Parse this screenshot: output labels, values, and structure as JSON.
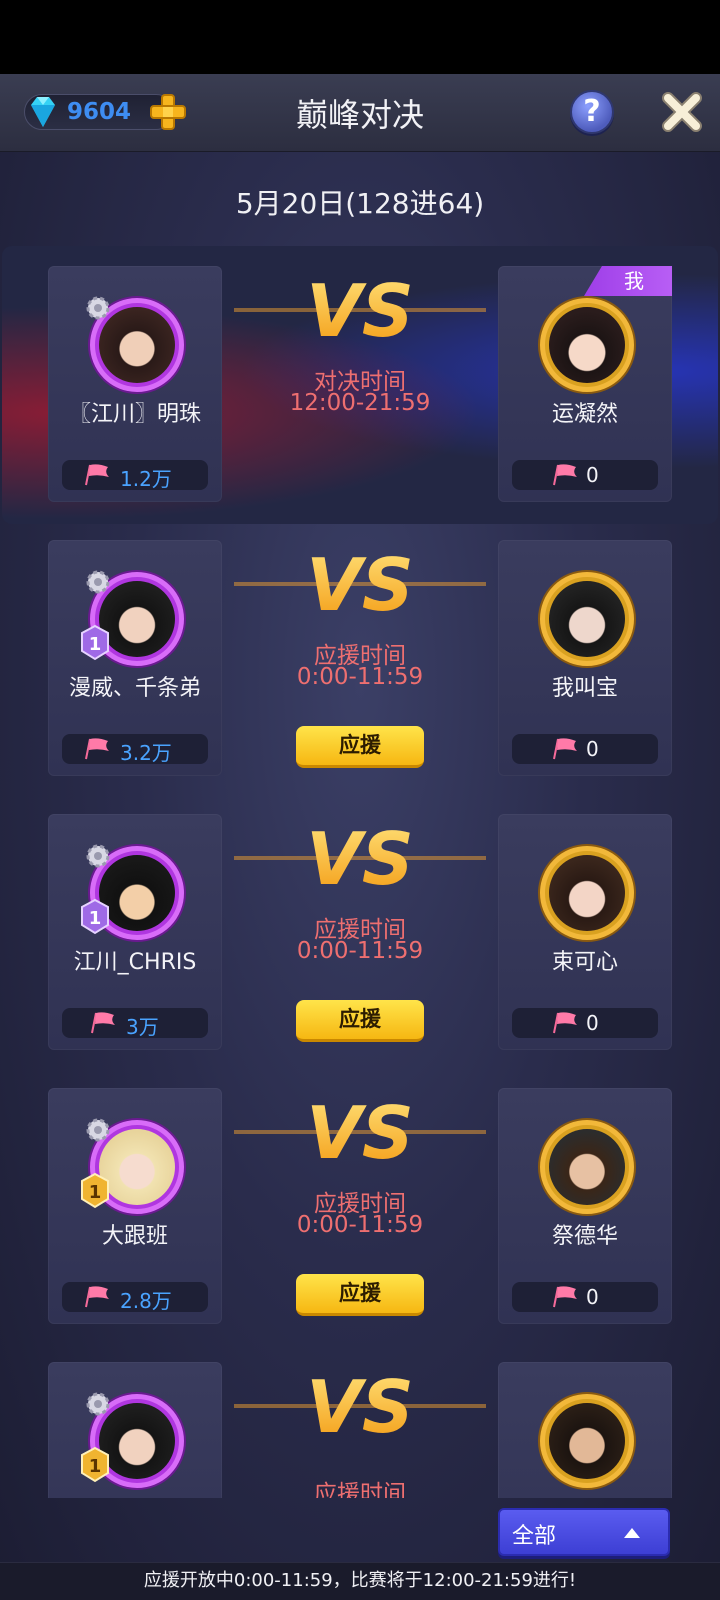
{
  "header": {
    "gem_count": "9604",
    "title": "巅峰对决",
    "help_label": "?"
  },
  "date": "5月20日(128进64)",
  "matches": [
    {
      "left": {
        "name": "〖江川〗明珠",
        "score": "1.2万",
        "rank": ""
      },
      "right": {
        "name": "运凝然",
        "score": "0",
        "tag": "我"
      },
      "time_label": "对决时间",
      "time_range": "12:00-21:59",
      "button": ""
    },
    {
      "left": {
        "name": "漫威、千条弟",
        "score": "3.2万",
        "rank": "1"
      },
      "right": {
        "name": "我叫宝",
        "score": "0"
      },
      "time_label": "应援时间",
      "time_range": "0:00-11:59",
      "button": "应援"
    },
    {
      "left": {
        "name": "江川_CHRIS",
        "score": "3万",
        "rank": "1"
      },
      "right": {
        "name": "束可心",
        "score": "0"
      },
      "time_label": "应援时间",
      "time_range": "0:00-11:59",
      "button": "应援"
    },
    {
      "left": {
        "name": "大跟班",
        "score": "2.8万",
        "rank": "1"
      },
      "right": {
        "name": "祭德华",
        "score": "0"
      },
      "time_label": "应援时间",
      "time_range": "0:00-11:59",
      "button": "应援"
    },
    {
      "left": {
        "name": "",
        "score": "",
        "rank": "1"
      },
      "right": {
        "name": "",
        "score": ""
      },
      "time_label": "应援时间",
      "time_range": "",
      "button": ""
    }
  ],
  "filter": {
    "label": "全部"
  },
  "footer": "应援开放中0:00-11:59，比赛将于12:00-21:59进行!",
  "colors": {
    "accent_gold": "#f6b712",
    "time_red": "#ee6f70",
    "score_blue": "#4aa3ff",
    "me_purple": "#b85ef5",
    "filter_blue": "#4c4ee4"
  }
}
